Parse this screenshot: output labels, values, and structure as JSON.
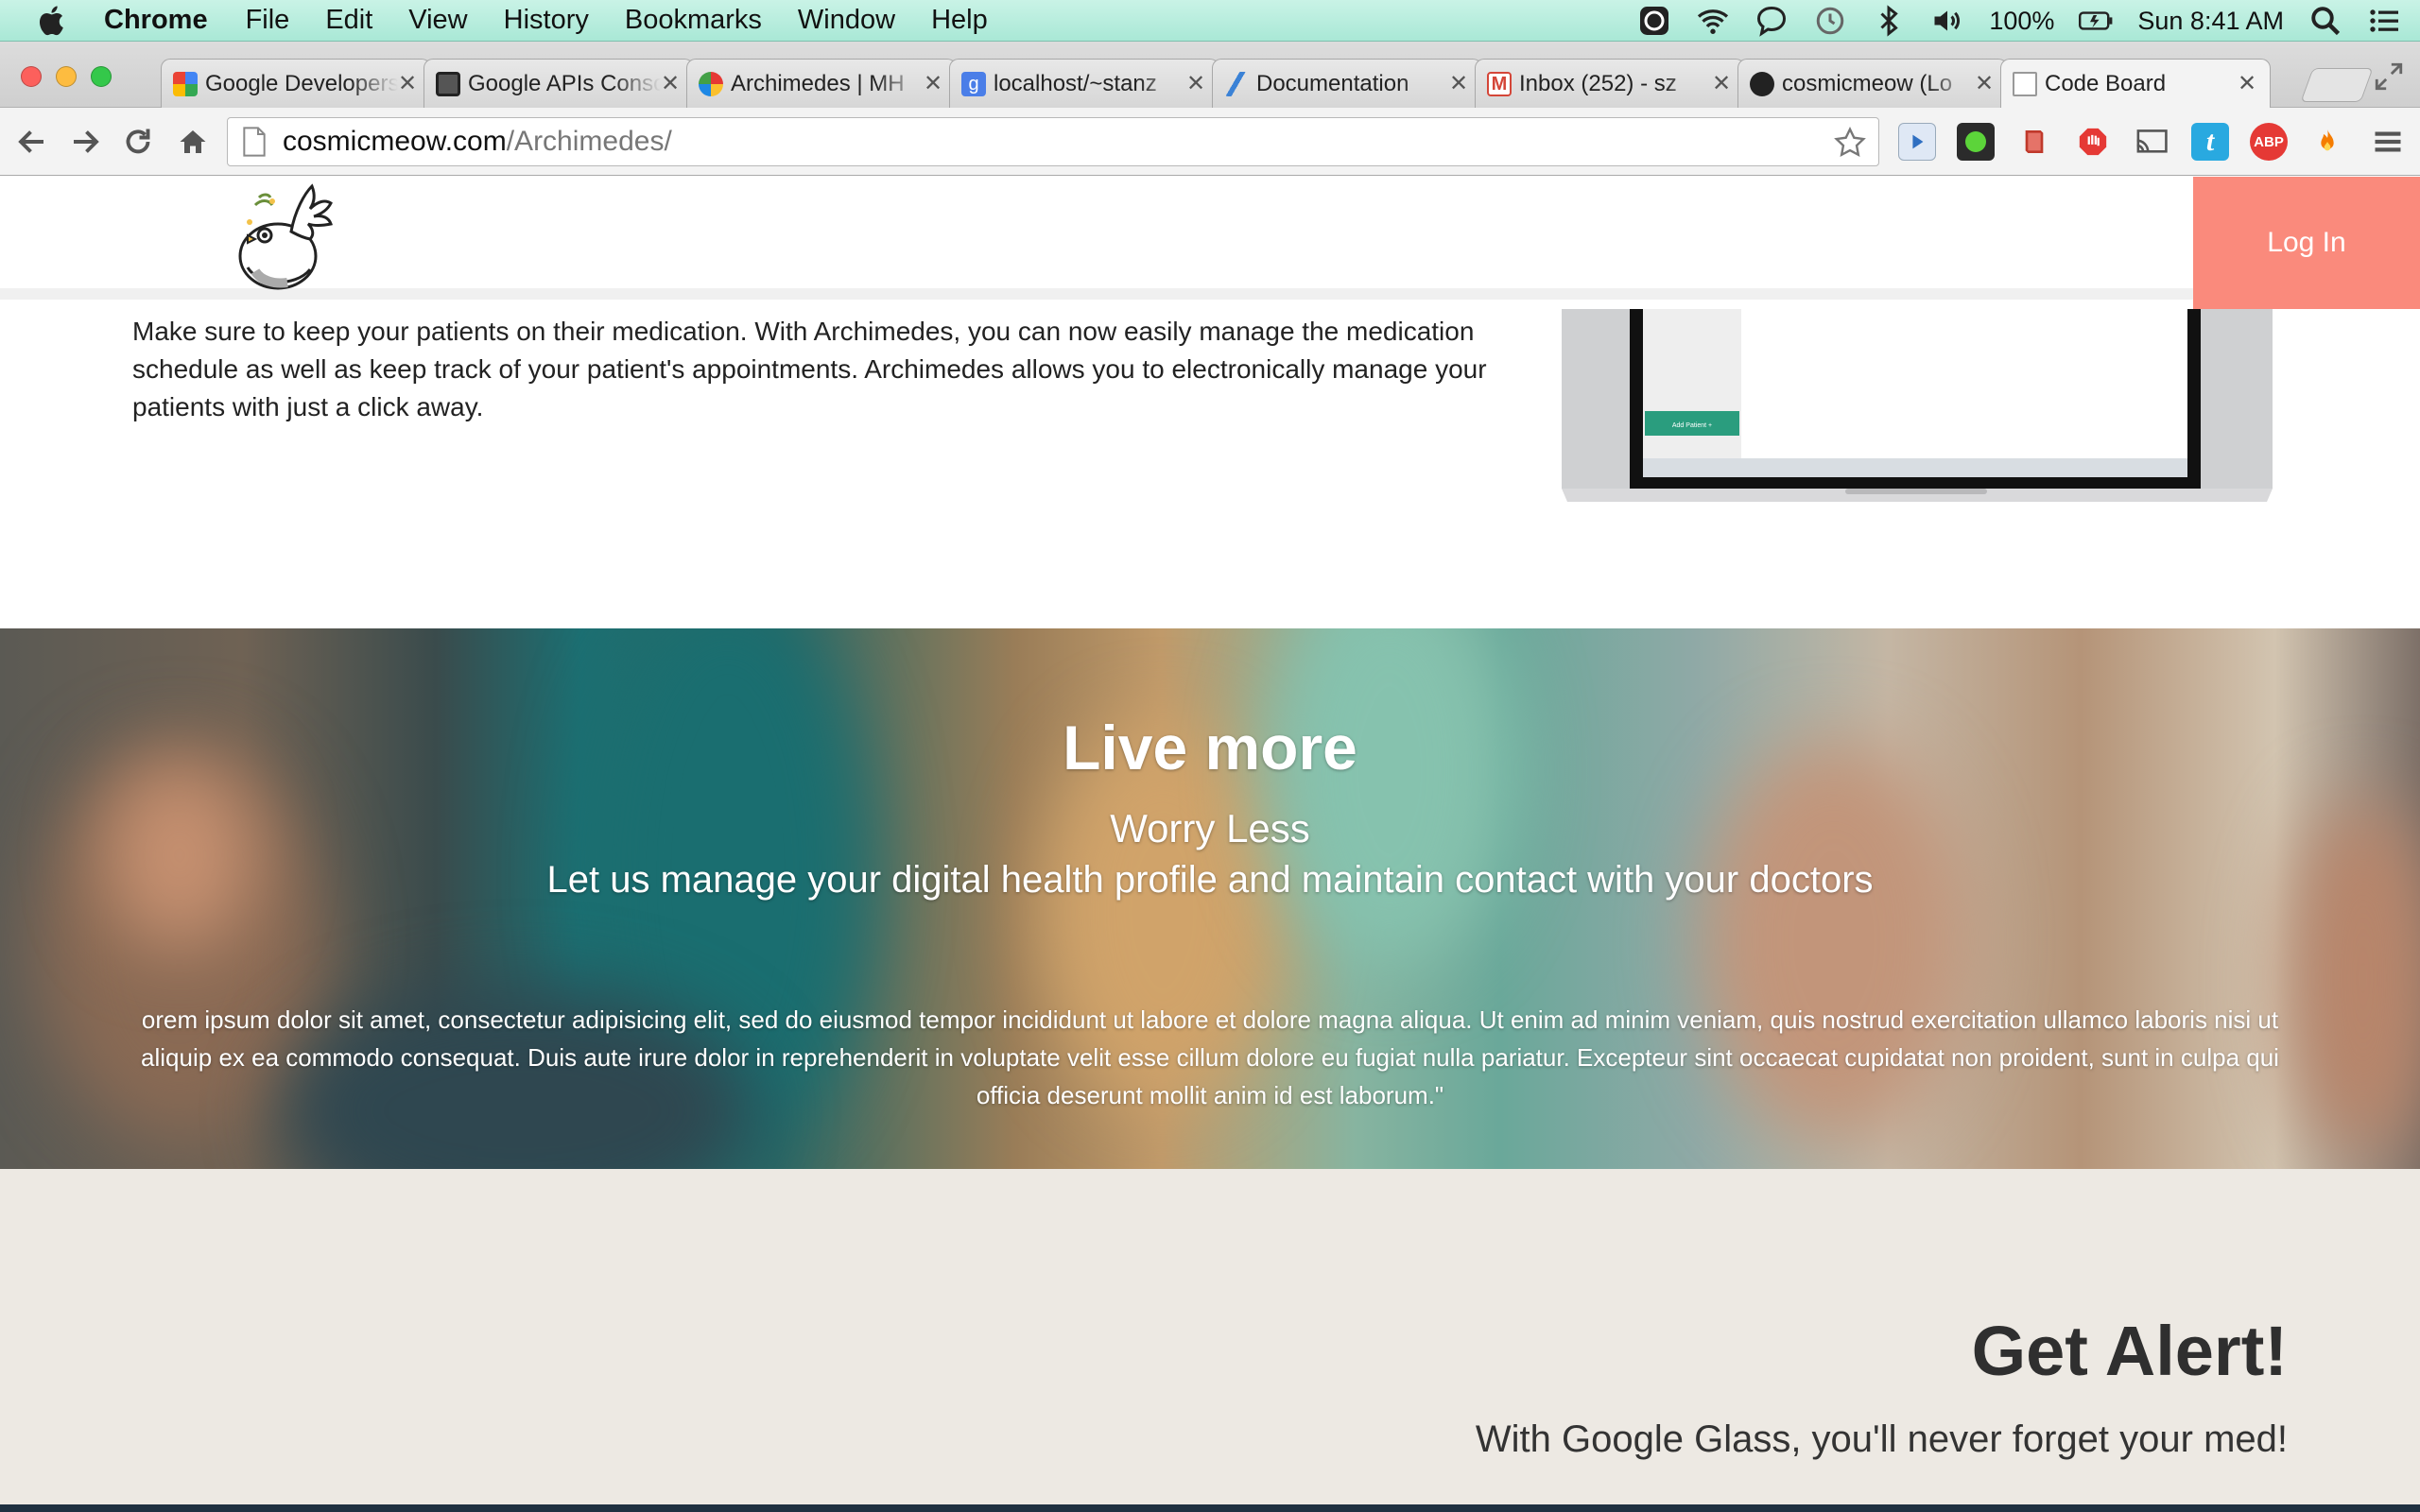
{
  "menubar": {
    "app": "Chrome",
    "items": [
      "File",
      "Edit",
      "View",
      "History",
      "Bookmarks",
      "Window",
      "Help"
    ],
    "battery": "100%",
    "clock": "Sun 8:41 AM"
  },
  "tabs": [
    {
      "title": "Google Developers",
      "favicon_color": "#4285f4"
    },
    {
      "title": "Google APIs Console",
      "favicon_color": "#444444"
    },
    {
      "title": "Archimedes | MH",
      "favicon_color": "#e8a21a"
    },
    {
      "title": "localhost/~stanz",
      "favicon_color": "#4a7ee8"
    },
    {
      "title": "Documentation",
      "favicon_color": "#3b82d6"
    },
    {
      "title": "Inbox (252) - sz",
      "favicon_color": "#d44638"
    },
    {
      "title": "cosmicmeow (Lo",
      "favicon_color": "#222222"
    },
    {
      "title": "Code Board",
      "favicon_color": "#ffffff"
    }
  ],
  "omnibox": {
    "domain": "cosmicmeow.com",
    "path": "/Archimedes/"
  },
  "extensions": [
    {
      "name": "play-extension",
      "color": "#dfe8f5",
      "label": ""
    },
    {
      "name": "green-dot-extension",
      "color": "#2b2b2b",
      "label": ""
    },
    {
      "name": "book-extension",
      "color": "#c0392b",
      "label": ""
    },
    {
      "name": "stop-hand-extension",
      "color": "#e53935",
      "label": ""
    },
    {
      "name": "cast-extension",
      "color": "#f3f3f3",
      "label": ""
    },
    {
      "name": "t-extension",
      "color": "#29a9e0",
      "label": "t"
    },
    {
      "name": "abp-extension",
      "color": "#e53935",
      "label": "ABP"
    },
    {
      "name": "fire-extension",
      "color": "#f57c00",
      "label": ""
    }
  ],
  "site": {
    "login_label": "Log In",
    "intro": "Make sure to keep your patients on their medication. With Archimedes, you can now easily manage the medication schedule as well as keep track of your patient's appointments. Archimedes allows you to electronically manage your patients with just a click away.",
    "laptop_button": "Add Patient +",
    "hero": {
      "title": "Live more",
      "subtitle": "Worry Less",
      "tagline": "Let us manage your digital health profile and maintain contact with your doctors",
      "body": "orem ipsum dolor sit amet, consectetur adipisicing elit, sed do eiusmod tempor incididunt ut labore et dolore magna aliqua. Ut enim ad minim veniam, quis nostrud exercitation ullamco laboris nisi ut aliquip ex ea commodo consequat. Duis aute irure dolor in reprehenderit in voluptate velit esse cillum dolore eu fugiat nulla pariatur. Excepteur sint occaecat cupidatat non proident, sunt in culpa qui officia deserunt mollit anim id est laborum.\""
    },
    "alert": {
      "title": "Get Alert!",
      "subtitle": "With Google Glass, you'll never forget your med!"
    }
  },
  "colors": {
    "login_bg": "#fa8a7c",
    "alert_bg": "#ede9e3",
    "laptop_button": "#2a9d7e"
  }
}
